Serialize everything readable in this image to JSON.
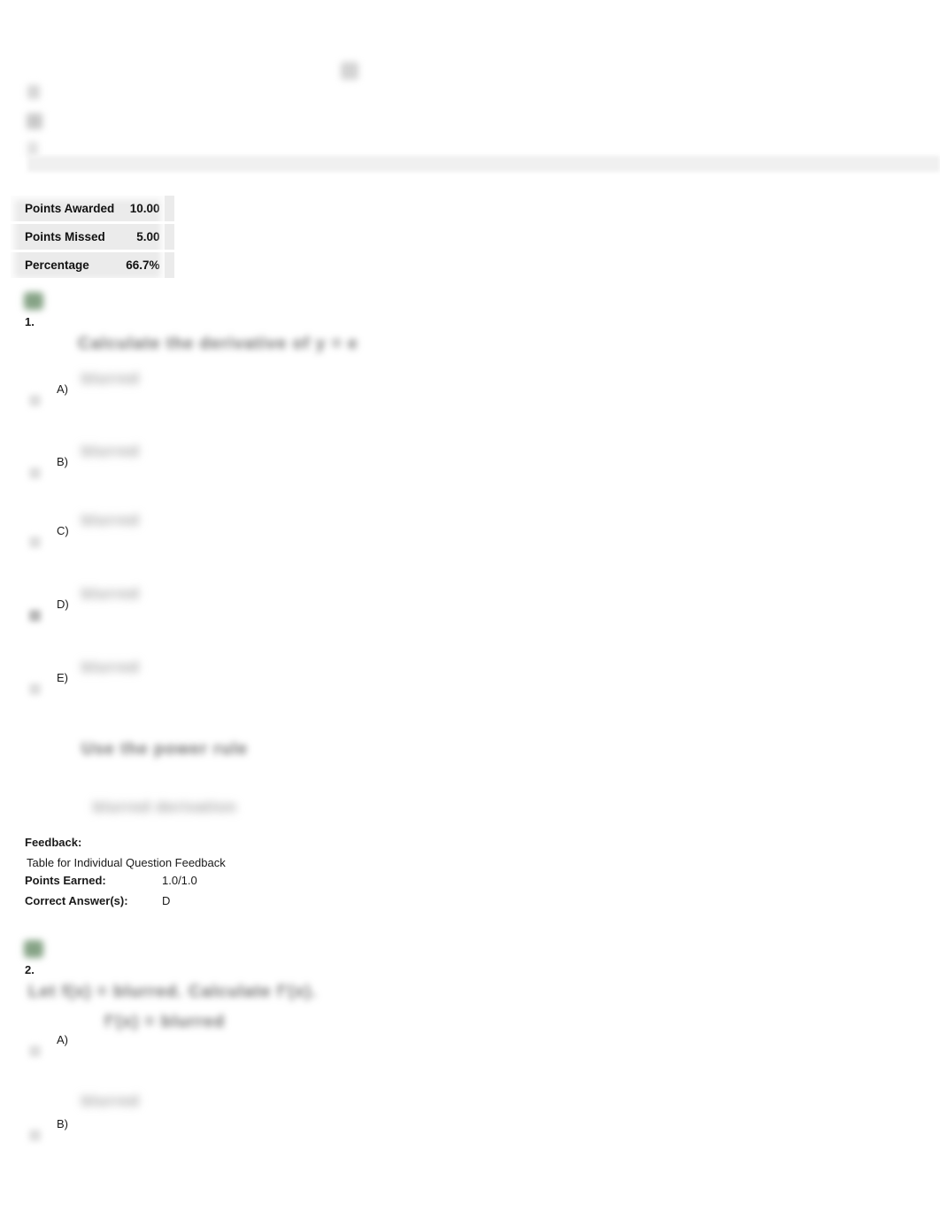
{
  "page": {
    "background_color": "#ffffff",
    "status_icon_color": "#86a386",
    "table_background_color": "#ebebeb"
  },
  "header": {
    "marks": [
      "redacted-mark",
      "redacted-mark",
      "redacted-mark"
    ],
    "top_icon": "blurred-icon",
    "divider": "divider-band"
  },
  "score_summary": {
    "rows": [
      {
        "label": "Points Awarded",
        "value": "10.00"
      },
      {
        "label": "Points Missed",
        "value": "5.00"
      },
      {
        "label": "Percentage",
        "value": "66.7%"
      }
    ]
  },
  "questions": [
    {
      "number": "1.",
      "status": "correct",
      "stem": "Calculate the derivative of y = e",
      "stem_continued": "",
      "options": [
        {
          "letter": "A)",
          "formula": "blurred",
          "selected": false
        },
        {
          "letter": "B)",
          "formula": "blurred",
          "selected": false
        },
        {
          "letter": "C)",
          "formula": "blurred",
          "selected": false
        },
        {
          "letter": "D)",
          "formula": "blurred",
          "selected": true
        },
        {
          "letter": "E)",
          "formula": "blurred",
          "selected": false
        }
      ],
      "solution": {
        "line_1": "Use the power rule",
        "line_2": "blurred derivation"
      },
      "feedback": {
        "label": "Feedback:",
        "table_caption": "Table for Individual Question Feedback",
        "points_earned_key": "Points Earned:",
        "points_earned_value": "1.0/1.0",
        "correct_answer_key": "Correct Answer(s):",
        "correct_answer_value": "D"
      }
    },
    {
      "number": "2.",
      "status": "correct",
      "stem": "Let f(x) = blurred. Calculate f'(x).",
      "stem_continued": "f'(x) = blurred",
      "options": [
        {
          "letter": "A)",
          "formula": "blurred",
          "selected": false
        },
        {
          "letter": "B)",
          "formula": "blurred",
          "selected": false
        }
      ]
    }
  ]
}
